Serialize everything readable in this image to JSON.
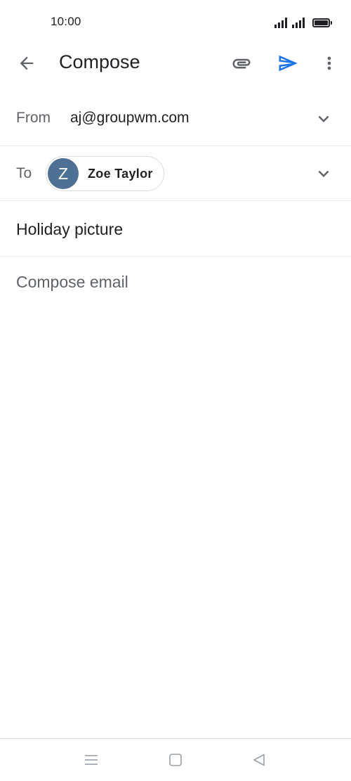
{
  "status_bar": {
    "time": "10:00",
    "icons": [
      "signal-icon",
      "signal-icon",
      "battery-icon"
    ]
  },
  "app_bar": {
    "title": "Compose",
    "icons": {
      "back": "arrow-back-icon",
      "attach": "paperclip-icon",
      "send": "send-icon",
      "more": "more-vert-icon"
    },
    "send_color": "#1a73e8"
  },
  "from": {
    "label": "From",
    "value": "aj@groupwm.com"
  },
  "to": {
    "label": "To",
    "recipients": [
      {
        "initial": "Z",
        "name": "Zoe Taylor",
        "avatar_color": "#4e7094"
      }
    ]
  },
  "subject": {
    "value": "Holiday picture"
  },
  "body": {
    "placeholder": "Compose email"
  },
  "nav_bar": {
    "icons": [
      "menu-icon",
      "home-icon",
      "back-icon"
    ]
  }
}
